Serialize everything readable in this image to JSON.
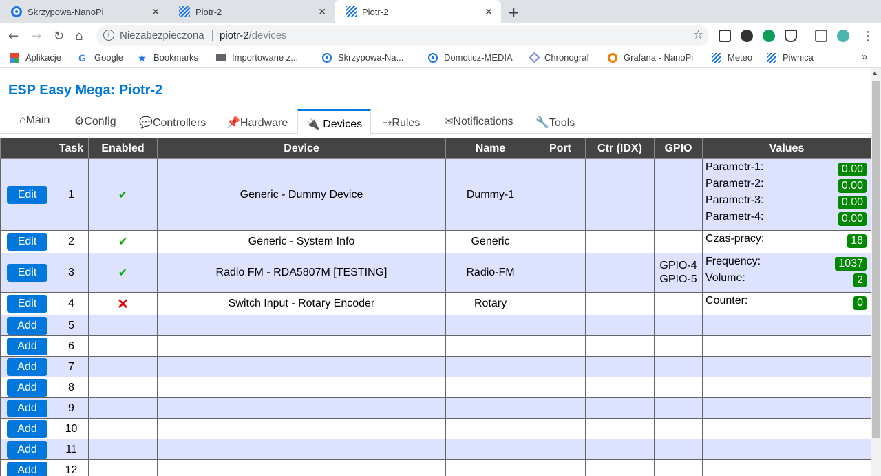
{
  "browser": {
    "tabs": [
      {
        "title": "Skrzypowa-NanoPi",
        "close": "✕"
      },
      {
        "title": "Piotr-2",
        "close": "✕"
      },
      {
        "title": "Piotr-2",
        "close": "✕"
      }
    ],
    "new_tab": "+",
    "address": {
      "security_label": "Niezabezpieczona",
      "host": "piotr-2",
      "path": "/devices"
    },
    "bookmarks": [
      "Aplikacje",
      "Google",
      "Bookmarks",
      "Importowane z...",
      "Skrzypowa-Na...",
      "Domoticz-MEDIA",
      "Chronograf",
      "Grafana - NanoPi",
      "Meteo",
      "Piwnica"
    ],
    "bookmarks_more": "»"
  },
  "page": {
    "title": "ESP Easy Mega: Piotr-2",
    "menu": [
      {
        "label": "⌂Main"
      },
      {
        "label": "⚙Config"
      },
      {
        "label": "💬Controllers"
      },
      {
        "label": "📌Hardware"
      },
      {
        "label": "🔌 Devices"
      },
      {
        "label": "⇢Rules"
      },
      {
        "label": "✉Notifications"
      },
      {
        "label": "🔧Tools"
      }
    ],
    "table": {
      "headers": [
        "",
        "Task",
        "Enabled",
        "Device",
        "Name",
        "Port",
        "Ctr (IDX)",
        "GPIO",
        "Values"
      ],
      "rows": [
        {
          "button": "Edit",
          "task": "1",
          "enabled": "✔",
          "device": "Generic - Dummy Device",
          "name": "Dummy-1",
          "port": "",
          "ctr": "",
          "gpio": [
            "",
            ""
          ],
          "values": [
            {
              "name": "Parametr-1:",
              "value": "0.00"
            },
            {
              "name": "Parametr-2:",
              "value": "0.00"
            },
            {
              "name": "Parametr-3:",
              "value": "0.00"
            },
            {
              "name": "Parametr-4:",
              "value": "0.00"
            }
          ]
        },
        {
          "button": "Edit",
          "task": "2",
          "enabled": "✔",
          "device": "Generic - System Info",
          "name": "Generic",
          "port": "",
          "ctr": "",
          "gpio": [
            "",
            ""
          ],
          "values": [
            {
              "name": "Czas-pracy:",
              "value": "18"
            }
          ]
        },
        {
          "button": "Edit",
          "task": "3",
          "enabled": "✔",
          "device": "Radio FM - RDA5807M [TESTING]",
          "name": "Radio-FM",
          "port": "",
          "ctr": "",
          "gpio": [
            "GPIO-4",
            "GPIO-5"
          ],
          "values": [
            {
              "name": "Frequency:",
              "value": "1037"
            },
            {
              "name": "Volume:",
              "value": "2"
            }
          ]
        },
        {
          "button": "Edit",
          "task": "4",
          "enabled": "✕",
          "device": "Switch Input - Rotary Encoder",
          "name": "Rotary",
          "port": "",
          "ctr": "",
          "gpio": [
            "",
            ""
          ],
          "values": [
            {
              "name": "Counter:",
              "value": "0"
            }
          ]
        },
        {
          "button": "Add",
          "task": "5"
        },
        {
          "button": "Add",
          "task": "6"
        },
        {
          "button": "Add",
          "task": "7"
        },
        {
          "button": "Add",
          "task": "8"
        },
        {
          "button": "Add",
          "task": "9"
        },
        {
          "button": "Add",
          "task": "10"
        },
        {
          "button": "Add",
          "task": "11"
        },
        {
          "button": "Add",
          "task": "12"
        }
      ]
    }
  },
  "colors": {
    "accent": "#0077dd",
    "value_badge": "#008800",
    "row_alt": "#dde3ff",
    "header_bg": "#444444",
    "enabled_ok": "#00aa00",
    "disabled": "#ee0000"
  }
}
